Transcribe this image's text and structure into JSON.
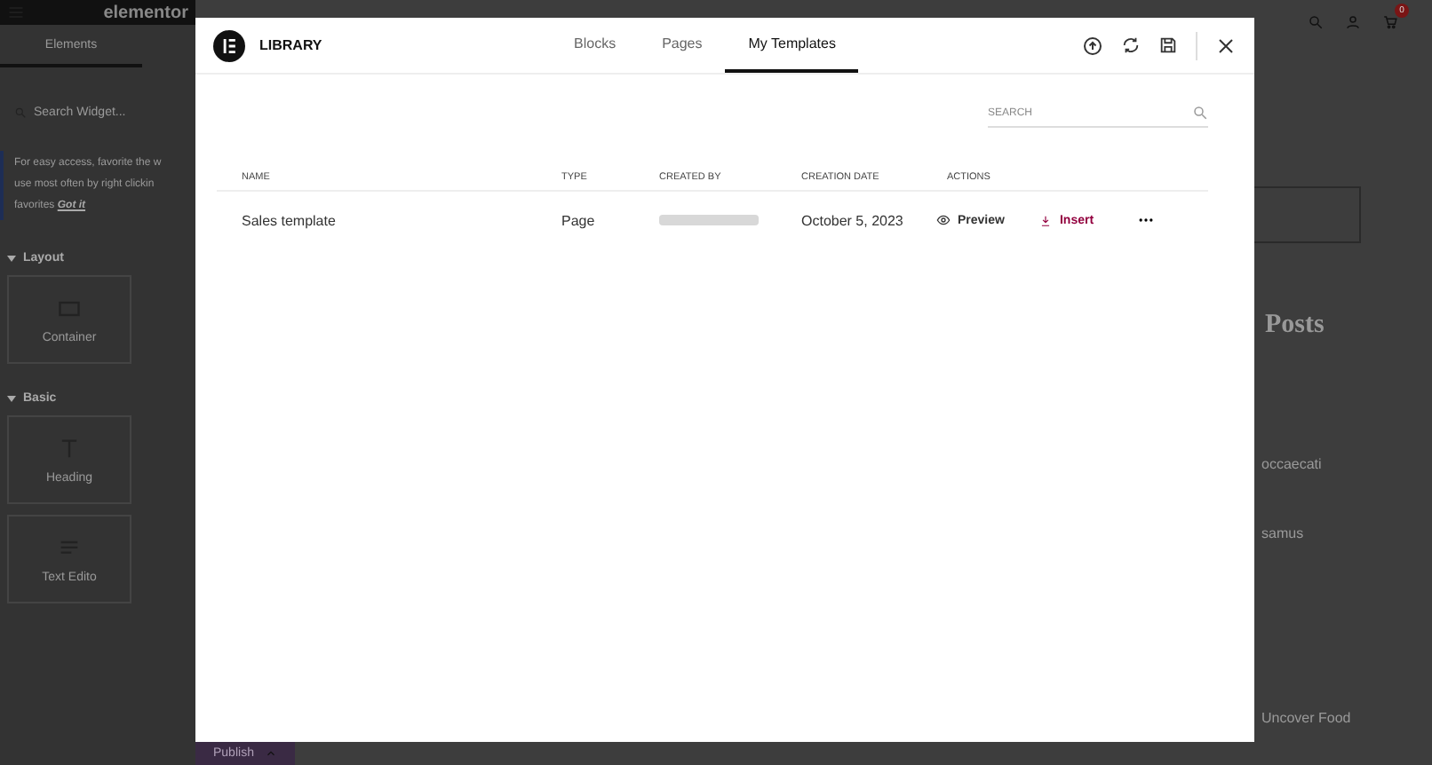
{
  "editor_sidebar": {
    "logo": "elementor",
    "tab": "Elements",
    "search": {
      "placeholder": "Search Widget..."
    },
    "notice": {
      "text": "For easy access, favorite the w",
      "text_2": "use most often by right clickin",
      "text_3": "favorites",
      "link": "Got it"
    },
    "sections": [
      {
        "title": "Layout",
        "expanded": true,
        "widgets": [
          "Container"
        ]
      },
      {
        "title": "Basic",
        "expanded": true,
        "widgets": [
          "Heading",
          "Text Edito"
        ]
      }
    ]
  },
  "publish_button": "Publish",
  "page_behind": {
    "cart_count": "0",
    "heading": "Posts",
    "lines": [
      "occaecati",
      "samus"
    ],
    "footer_item": "Uncover Food"
  },
  "library": {
    "title": "LIBRARY",
    "tabs": [
      {
        "label": "Blocks",
        "selected": false
      },
      {
        "label": "Pages",
        "selected": false
      },
      {
        "label": "My Templates",
        "selected": true
      }
    ],
    "search": {
      "placeholder": "SEARCH"
    },
    "columns": [
      "NAME",
      "TYPE",
      "CREATED BY",
      "CREATION DATE",
      "ACTIONS"
    ],
    "rows": [
      {
        "name": "Sales template",
        "type": "Page",
        "date": "October 5, 2023",
        "preview": "Preview",
        "insert": "Insert"
      }
    ]
  }
}
